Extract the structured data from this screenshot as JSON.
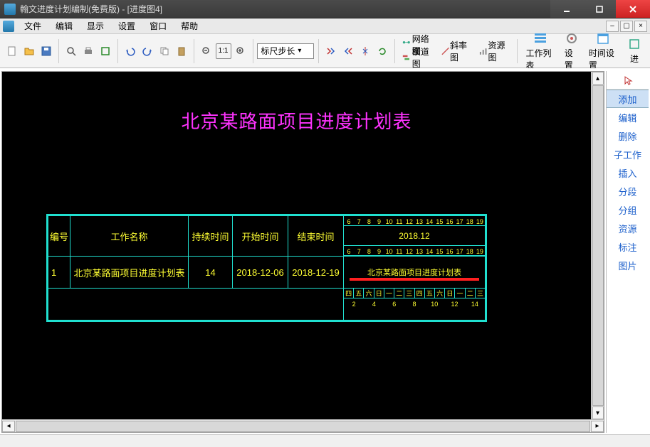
{
  "window": {
    "title": "翰文进度计划编制(免费版) - [进度图4]"
  },
  "menubar": {
    "items": [
      "文件",
      "编辑",
      "显示",
      "设置",
      "窗口",
      "帮助"
    ]
  },
  "toolbar": {
    "ruler_combo": "标尺步长",
    "view_section": {
      "top": "网络图",
      "bottom": "横道图"
    },
    "slope_btn": "斜率图",
    "resource_btn": "资源图",
    "worklist_btn": "工作列表",
    "settings_btn": "设置",
    "time_settings_btn": "时间设置",
    "progress_btn": "进"
  },
  "chart": {
    "title": "北京某路面项目进度计划表",
    "headers": {
      "id": "编号",
      "name": "工作名称",
      "duration": "持续时间",
      "start": "开始时间",
      "end": "结束时间"
    },
    "month_label": "2018.12",
    "top_ruler_days": [
      "6",
      "7",
      "8",
      "9",
      "10",
      "11",
      "12",
      "13",
      "14",
      "15",
      "16",
      "17",
      "18",
      "19"
    ],
    "mid_ruler_days": [
      "6",
      "7",
      "8",
      "9",
      "10",
      "11",
      "12",
      "13",
      "14",
      "15",
      "16",
      "17",
      "18",
      "19"
    ],
    "weekdays": [
      "四",
      "五",
      "六",
      "日",
      "一",
      "二",
      "三",
      "四",
      "五",
      "六",
      "日",
      "一",
      "二",
      "三"
    ],
    "bottom_ruler_days": [
      "2",
      "4",
      "6",
      "8",
      "10",
      "12",
      "14"
    ],
    "rows": [
      {
        "id": "1",
        "name": "北京某路面项目进度计划表",
        "duration": "14",
        "start": "2018-12-06",
        "end": "2018-12-19",
        "bar_label": "北京某路面项目进度计划表"
      }
    ]
  },
  "sidebar": {
    "items": [
      "添加",
      "编辑",
      "删除",
      "子工作",
      "插入",
      "分段",
      "分组",
      "资源",
      "标注",
      "图片"
    ],
    "selected_index": 0
  }
}
